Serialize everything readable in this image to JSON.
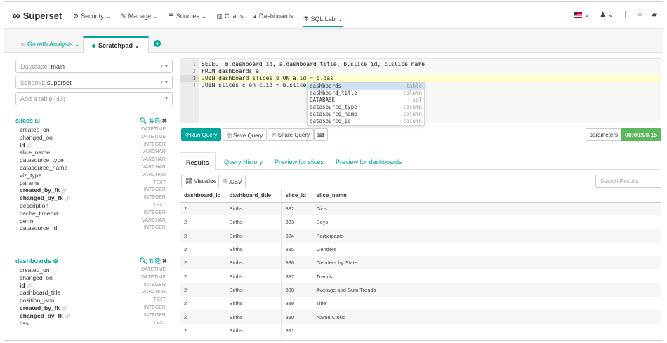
{
  "nav": {
    "brand": "Superset",
    "menu": [
      {
        "label": "Security",
        "icon": "cogs-icon"
      },
      {
        "label": "Manage",
        "icon": "wrench-icon"
      },
      {
        "label": "Sources",
        "icon": "database-icon"
      },
      {
        "label": "Charts",
        "icon": "bar-chart-icon"
      },
      {
        "label": "Dashboards",
        "icon": "dashboard-icon"
      },
      {
        "label": "SQL Lab",
        "icon": "flask-icon"
      }
    ]
  },
  "query_tabs": [
    {
      "label": "Growth Analysis",
      "active": false
    },
    {
      "label": "Scratchpad",
      "active": true
    }
  ],
  "left": {
    "database": {
      "prefix": "Database:",
      "value": "main"
    },
    "schema": {
      "prefix": "Schema:",
      "value": "superset"
    },
    "add_table": "Add a table (43)",
    "tables": [
      {
        "name": "slices",
        "columns": [
          {
            "name": "created_on",
            "type": "DATETIME"
          },
          {
            "name": "changed_on",
            "type": "DATETIME"
          },
          {
            "name": "id",
            "type": "INTEGER",
            "bold": true,
            "key": true
          },
          {
            "name": "slice_name",
            "type": "VARCHAR"
          },
          {
            "name": "datasource_type",
            "type": "VARCHAR"
          },
          {
            "name": "datasource_name",
            "type": "VARCHAR"
          },
          {
            "name": "viz_type",
            "type": "VARCHAR"
          },
          {
            "name": "params",
            "type": "TEXT"
          },
          {
            "name": "created_by_fk",
            "type": "INTEGER",
            "bold": true,
            "fk": true
          },
          {
            "name": "changed_by_fk",
            "type": "INTEGER",
            "bold": true,
            "fk": true
          },
          {
            "name": "description",
            "type": "TEXT"
          },
          {
            "name": "cache_timeout",
            "type": "INTEGER"
          },
          {
            "name": "perm",
            "type": "VARCHAR"
          },
          {
            "name": "datasource_id",
            "type": "INTEGER"
          }
        ]
      },
      {
        "name": "dashboards",
        "columns": [
          {
            "name": "created_on",
            "type": "DATETIME"
          },
          {
            "name": "changed_on",
            "type": "DATETIME"
          },
          {
            "name": "id",
            "type": "INTEGER",
            "bold": true,
            "key": true
          },
          {
            "name": "dashboard_title",
            "type": "VARCHAR"
          },
          {
            "name": "position_json",
            "type": "TEXT"
          },
          {
            "name": "created_by_fk",
            "type": "INTEGER",
            "bold": true,
            "fk": true
          },
          {
            "name": "changed_by_fk",
            "type": "INTEGER",
            "bold": true,
            "fk": true
          },
          {
            "name": "css",
            "type": "TEXT"
          }
        ]
      }
    ]
  },
  "editor": {
    "lines": [
      "SELECT b.dashboard_id, a.dashboard_title, b.slice_id, c.slice_name",
      "FROM dashboards a",
      "JOIN dashboard_slices b ON a.id = b.das",
      "JOIN slices c on c.id = b.slice_id"
    ],
    "autocomplete": [
      {
        "value": "dashboards",
        "kind": "table"
      },
      {
        "value": "dashboard_title",
        "kind": "column"
      },
      {
        "value": "DATABASE",
        "kind": "sql"
      },
      {
        "value": "datasource_type",
        "kind": "column"
      },
      {
        "value": "datasource_name",
        "kind": "column"
      },
      {
        "value": "datasource_id",
        "kind": "column"
      }
    ]
  },
  "query_bar": {
    "run": "Run Query",
    "save": "Save Query",
    "share": "Share Query",
    "parameters": "parameters",
    "timer": "00:00:00.15"
  },
  "result_tabs": [
    "Results",
    "Query History",
    "Preview for slices",
    "Preview for dashboards"
  ],
  "result_tools": {
    "visualize": "Visualize",
    "csv": ".CSV",
    "search_placeholder": "Search Results"
  },
  "results": {
    "columns": [
      "dashboard_id",
      "dashboard_title",
      "slice_id",
      "slice_name"
    ],
    "rows": [
      [
        "2",
        "Births",
        "882",
        "Girls"
      ],
      [
        "2",
        "Births",
        "883",
        "Boys"
      ],
      [
        "2",
        "Births",
        "884",
        "Participants"
      ],
      [
        "2",
        "Births",
        "885",
        "Genders"
      ],
      [
        "2",
        "Births",
        "886",
        "Genders by State"
      ],
      [
        "2",
        "Births",
        "887",
        "Trends"
      ],
      [
        "2",
        "Births",
        "888",
        "Average and Sum Trends"
      ],
      [
        "2",
        "Births",
        "889",
        "Title"
      ],
      [
        "2",
        "Births",
        "890",
        "Name Cloud"
      ],
      [
        "2",
        "Births",
        "891",
        ""
      ]
    ]
  }
}
